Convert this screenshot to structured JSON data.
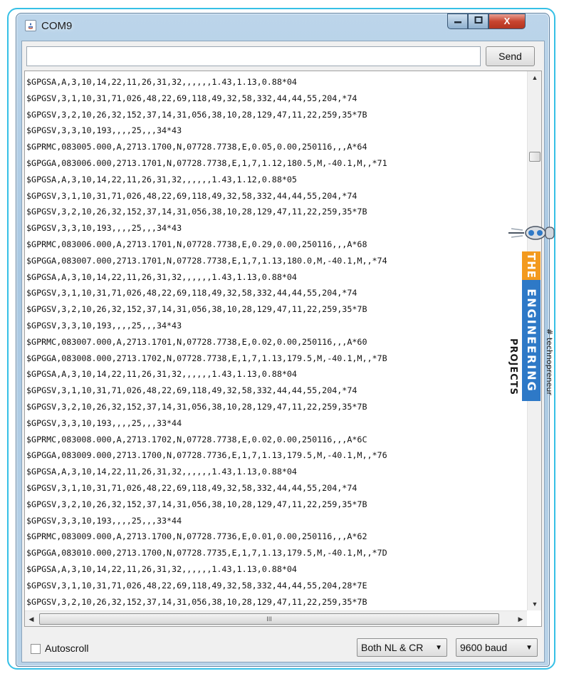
{
  "window": {
    "title": "COM9",
    "controls": {
      "minimize": "—",
      "maximize": "□",
      "close": "X"
    }
  },
  "send": {
    "input_value": "",
    "button_label": "Send"
  },
  "console": {
    "lines": [
      "$GPGSA,A,3,10,14,22,11,26,31,32,,,,,,1.43,1.13,0.88*04",
      "$GPGSV,3,1,10,31,71,026,48,22,69,118,49,32,58,332,44,44,55,204,*74",
      "$GPGSV,3,2,10,26,32,152,37,14,31,056,38,10,28,129,47,11,22,259,35*7B",
      "$GPGSV,3,3,10,193,,,,25,,,34*43",
      "$GPRMC,083005.000,A,2713.1700,N,07728.7738,E,0.05,0.00,250116,,,A*64",
      "$GPGGA,083006.000,2713.1701,N,07728.7738,E,1,7,1.12,180.5,M,-40.1,M,,*71",
      "$GPGSA,A,3,10,14,22,11,26,31,32,,,,,,1.43,1.12,0.88*05",
      "$GPGSV,3,1,10,31,71,026,48,22,69,118,49,32,58,332,44,44,55,204,*74",
      "$GPGSV,3,2,10,26,32,152,37,14,31,056,38,10,28,129,47,11,22,259,35*7B",
      "$GPGSV,3,3,10,193,,,,25,,,34*43",
      "$GPRMC,083006.000,A,2713.1701,N,07728.7738,E,0.29,0.00,250116,,,A*68",
      "$GPGGA,083007.000,2713.1701,N,07728.7738,E,1,7,1.13,180.0,M,-40.1,M,,*74",
      "$GPGSA,A,3,10,14,22,11,26,31,32,,,,,,1.43,1.13,0.88*04",
      "$GPGSV,3,1,10,31,71,026,48,22,69,118,49,32,58,332,44,44,55,204,*74",
      "$GPGSV,3,2,10,26,32,152,37,14,31,056,38,10,28,129,47,11,22,259,35*7B",
      "$GPGSV,3,3,10,193,,,,25,,,34*43",
      "$GPRMC,083007.000,A,2713.1701,N,07728.7738,E,0.02,0.00,250116,,,A*60",
      "$GPGGA,083008.000,2713.1702,N,07728.7738,E,1,7,1.13,179.5,M,-40.1,M,,*7B",
      "$GPGSA,A,3,10,14,22,11,26,31,32,,,,,,1.43,1.13,0.88*04",
      "$GPGSV,3,1,10,31,71,026,48,22,69,118,49,32,58,332,44,44,55,204,*74",
      "$GPGSV,3,2,10,26,32,152,37,14,31,056,38,10,28,129,47,11,22,259,35*7B",
      "$GPGSV,3,3,10,193,,,,25,,,33*44",
      "$GPRMC,083008.000,A,2713.1702,N,07728.7738,E,0.02,0.00,250116,,,A*6C",
      "$GPGGA,083009.000,2713.1700,N,07728.7736,E,1,7,1.13,179.5,M,-40.1,M,,*76",
      "$GPGSA,A,3,10,14,22,11,26,31,32,,,,,,1.43,1.13,0.88*04",
      "$GPGSV,3,1,10,31,71,026,48,22,69,118,49,32,58,332,44,44,55,204,*74",
      "$GPGSV,3,2,10,26,32,152,37,14,31,056,38,10,28,129,47,11,22,259,35*7B",
      "$GPGSV,3,3,10,193,,,,25,,,33*44",
      "$GPRMC,083009.000,A,2713.1700,N,07728.7736,E,0.01,0.00,250116,,,A*62",
      "$GPGGA,083010.000,2713.1700,N,07728.7735,E,1,7,1.13,179.5,M,-40.1,M,,*7D",
      "$GPGSA,A,3,10,14,22,11,26,31,32,,,,,,1.43,1.13,0.88*04",
      "$GPGSV,3,1,10,31,71,026,48,22,69,118,49,32,58,332,44,44,55,204,28*7E",
      "$GPGSV,3,2,10,26,32,152,37,14,31,056,38,10,28,129,47,11,22,259,35*7B"
    ]
  },
  "scrollbar": {
    "grip": "III"
  },
  "footer": {
    "autoscroll_label": "Autoscroll",
    "autoscroll_checked": false,
    "line_ending": "Both NL & CR",
    "baud_rate": "9600 baud"
  },
  "watermark": {
    "the": "THE",
    "engineering": "ENGINEERING",
    "projects": "PROJECTS",
    "tagline": "# technopreneur",
    "colors": {
      "orange": "#f39a1e",
      "blue": "#2e79c7",
      "dark": "#1a1a1a"
    }
  }
}
